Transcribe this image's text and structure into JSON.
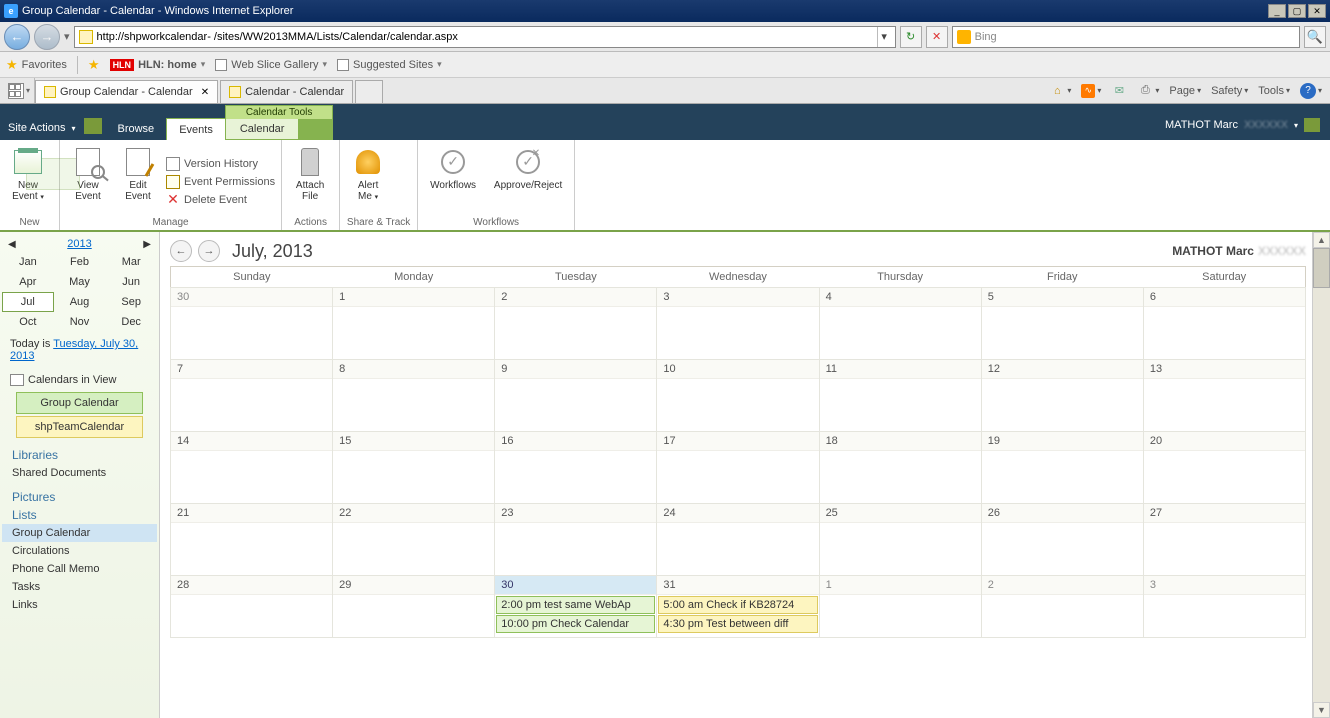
{
  "window": {
    "title": "Group Calendar - Calendar - Windows Internet Explorer"
  },
  "address": {
    "url": "http://shpworkcalendar-            /sites/WW2013MMA/Lists/Calendar/calendar.aspx"
  },
  "search": {
    "placeholder": "Bing"
  },
  "favbar": {
    "favorites": "Favorites",
    "hln": "HLN: home",
    "webslice": "Web Slice Gallery",
    "suggested": "Suggested Sites"
  },
  "ietabs": {
    "t1": "Group Calendar - Calendar",
    "t2": "Calendar - Calendar"
  },
  "cmdbar": {
    "page": "Page",
    "safety": "Safety",
    "tools": "Tools"
  },
  "sp": {
    "site_actions": "Site Actions",
    "browse": "Browse",
    "ctx_label": "Calendar Tools",
    "events": "Events",
    "calendar": "Calendar",
    "user": "MATHOT Marc"
  },
  "ribbon": {
    "new_event": "New\nEvent",
    "view_event": "View\nEvent",
    "edit_event": "Edit\nEvent",
    "version_history": "Version History",
    "event_permissions": "Event Permissions",
    "delete_event": "Delete Event",
    "attach_file": "Attach\nFile",
    "alert_me": "Alert\nMe",
    "workflows": "Workflows",
    "approve_reject": "Approve/Reject",
    "g_new": "New",
    "g_manage": "Manage",
    "g_actions": "Actions",
    "g_share": "Share & Track",
    "g_wf": "Workflows"
  },
  "minical": {
    "year": "2013",
    "months": [
      "Jan",
      "Feb",
      "Mar",
      "Apr",
      "May",
      "Jun",
      "Jul",
      "Aug",
      "Sep",
      "Oct",
      "Nov",
      "Dec"
    ],
    "sel_idx": 6,
    "today_prefix": "Today is ",
    "today": "Tuesday, July 30, 2013"
  },
  "civ": {
    "title": "Calendars in View",
    "c1": "Group Calendar",
    "c2": "shpTeamCalendar"
  },
  "nav": {
    "libraries": "Libraries",
    "shared_docs": "Shared Documents",
    "pictures": "Pictures",
    "lists": "Lists",
    "group_cal": "Group Calendar",
    "circulations": "Circulations",
    "phone": "Phone Call Memo",
    "tasks": "Tasks",
    "links": "Links"
  },
  "cal": {
    "title": "July, 2013",
    "user": "MATHOT Marc",
    "dow": [
      "Sunday",
      "Monday",
      "Tuesday",
      "Wednesday",
      "Thursday",
      "Friday",
      "Saturday"
    ],
    "weeks": [
      [
        {
          "n": "30",
          "out": true
        },
        {
          "n": "1"
        },
        {
          "n": "2"
        },
        {
          "n": "3"
        },
        {
          "n": "4"
        },
        {
          "n": "5"
        },
        {
          "n": "6"
        }
      ],
      [
        {
          "n": "7"
        },
        {
          "n": "8"
        },
        {
          "n": "9"
        },
        {
          "n": "10"
        },
        {
          "n": "11"
        },
        {
          "n": "12"
        },
        {
          "n": "13"
        }
      ],
      [
        {
          "n": "14"
        },
        {
          "n": "15"
        },
        {
          "n": "16"
        },
        {
          "n": "17"
        },
        {
          "n": "18"
        },
        {
          "n": "19"
        },
        {
          "n": "20"
        }
      ],
      [
        {
          "n": "21"
        },
        {
          "n": "22"
        },
        {
          "n": "23"
        },
        {
          "n": "24"
        },
        {
          "n": "25"
        },
        {
          "n": "26"
        },
        {
          "n": "27"
        }
      ],
      [
        {
          "n": "28"
        },
        {
          "n": "29"
        },
        {
          "n": "30",
          "today": true,
          "evts": [
            {
              "t": "2:00 pm test same WebAp",
              "c": "g"
            },
            {
              "t": "10:00 pm Check Calendar",
              "c": "g"
            }
          ]
        },
        {
          "n": "31",
          "evts": [
            {
              "t": "5:00 am Check if KB28724",
              "c": "y"
            },
            {
              "t": "4:30 pm Test between diff",
              "c": "y"
            }
          ]
        },
        {
          "n": "1",
          "out": true
        },
        {
          "n": "2",
          "out": true
        },
        {
          "n": "3",
          "out": true
        }
      ]
    ]
  }
}
